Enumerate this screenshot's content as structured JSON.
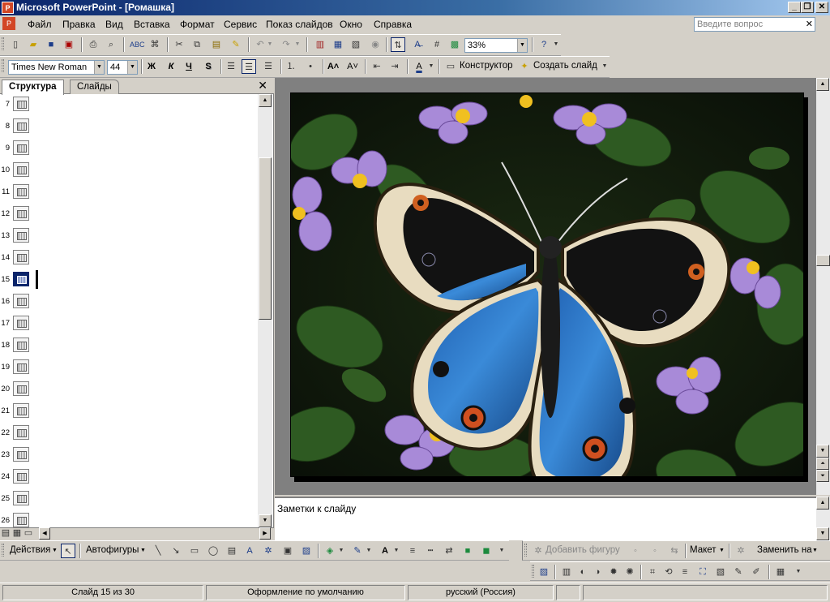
{
  "titlebar": {
    "title": "Microsoft PowerPoint - [Ромашка]",
    "app_icon": "P"
  },
  "menu": {
    "items": [
      "Файл",
      "Правка",
      "Вид",
      "Вставка",
      "Формат",
      "Сервис",
      "Показ слайдов",
      "Окно",
      "Справка"
    ],
    "ask_placeholder": "Введите вопрос"
  },
  "standard_toolbar": {
    "zoom": "33%"
  },
  "formatting_toolbar": {
    "font": "Times New Roman",
    "font_size": "44",
    "bold": "Ж",
    "italic": "К",
    "underline": "Ч",
    "shadow": "S",
    "design_label": "Конструктор",
    "new_slide_label": "Создать слайд"
  },
  "left_pane": {
    "tabs": [
      "Структура",
      "Слайды"
    ],
    "active_tab": "Структура",
    "rows": [
      "7",
      "8",
      "9",
      "10",
      "11",
      "12",
      "13",
      "14",
      "15",
      "16",
      "17",
      "18",
      "19",
      "20",
      "21",
      "22",
      "23",
      "24",
      "25",
      "26"
    ],
    "selected": "15"
  },
  "notes": {
    "text": "Заметки к слайду"
  },
  "drawing_toolbar": {
    "actions": "Действия",
    "autoshapes": "Автофигуры"
  },
  "diagram_toolbar": {
    "add_shape": "Добавить фигуру",
    "layout": "Макет",
    "change_to": "Заменить на"
  },
  "status": {
    "slide": "Слайд 15 из 30",
    "design": "Оформление по умолчанию",
    "language": "русский (Россия)"
  },
  "colors": {
    "title_start": "#0a246a",
    "title_end": "#a6caf0",
    "selection": "#0a246a",
    "app_accent": "#d24726"
  }
}
